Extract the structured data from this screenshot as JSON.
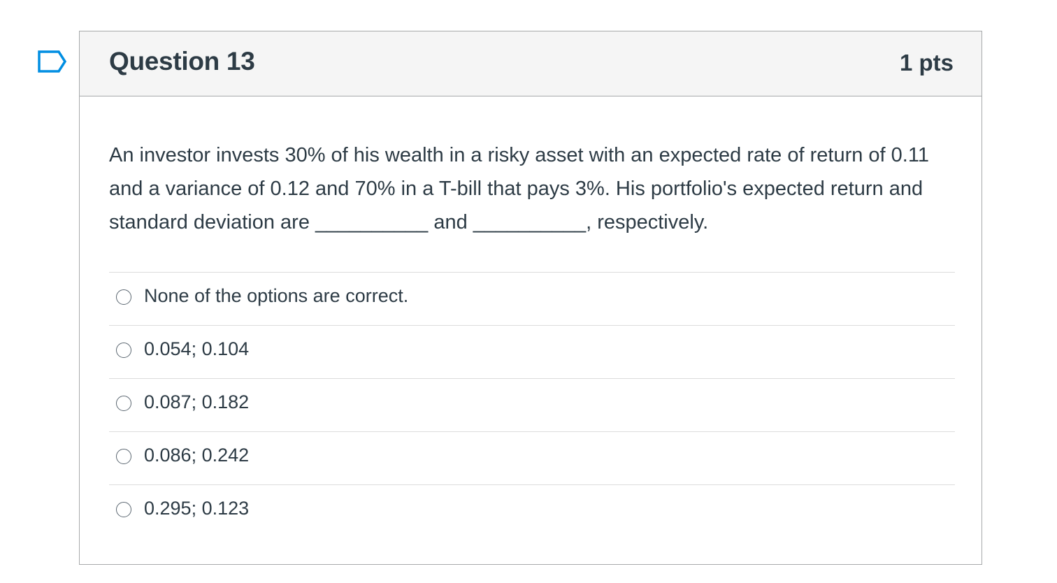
{
  "question": {
    "title": "Question 13",
    "points": "1 pts",
    "text": "An investor invests 30% of his wealth in a risky asset with an expected rate of return of 0.11 and a variance of 0.12 and 70% in a T-bill that pays 3%. His portfolio's expected return and standard deviation are __________ and __________, respectively.",
    "flag_icon": "bookmark-flag-icon",
    "accent_color": "#008ee2"
  },
  "answers": [
    {
      "label": "None of the options are correct."
    },
    {
      "label": "0.054; 0.104"
    },
    {
      "label": "0.087; 0.182"
    },
    {
      "label": "0.086; 0.242"
    },
    {
      "label": "0.295; 0.123"
    }
  ]
}
